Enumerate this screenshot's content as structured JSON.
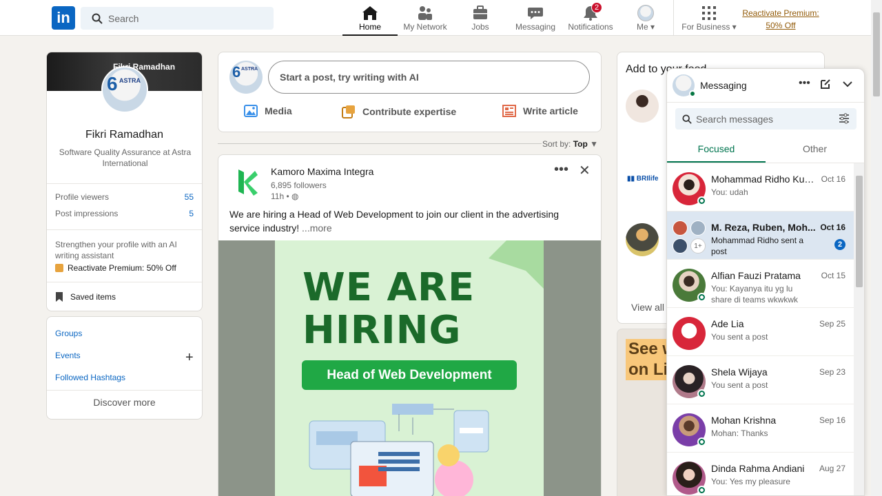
{
  "nav": {
    "logo_text": "in",
    "search_placeholder": "Search",
    "items": [
      {
        "label": "Home",
        "icon": "home-icon",
        "active": true
      },
      {
        "label": "My Network",
        "icon": "network-icon"
      },
      {
        "label": "Jobs",
        "icon": "briefcase-icon"
      },
      {
        "label": "Messaging",
        "icon": "chat-icon"
      },
      {
        "label": "Notifications",
        "icon": "bell-icon",
        "badge": "2"
      },
      {
        "label": "Me",
        "icon": "avatar-icon"
      },
      {
        "label": "For Business",
        "icon": "grid-icon"
      }
    ],
    "premium_line1": "Reactivate Premium:",
    "premium_line2": "50% Off"
  },
  "profile": {
    "cover_text": "Fikri Ramadhan",
    "name": "Fikri Ramadhan",
    "title": "Software Quality Assurance at Astra International",
    "stats": [
      {
        "label": "Profile viewers",
        "value": "55"
      },
      {
        "label": "Post impressions",
        "value": "5"
      }
    ],
    "promo_text": "Strengthen your profile with an AI writing assistant",
    "promo_link": "Reactivate Premium: 50% Off",
    "saved_items": "Saved items"
  },
  "left_links": {
    "groups": "Groups",
    "events": "Events",
    "hashtags": "Followed Hashtags",
    "discover": "Discover more"
  },
  "share": {
    "placeholder": "Start a post, try writing with AI",
    "actions": [
      "Media",
      "Contribute expertise",
      "Write article"
    ]
  },
  "sort": {
    "label": "Sort by:",
    "value": "Top"
  },
  "post": {
    "company": "Kamoro Maxima Integra",
    "followers": "6,895 followers",
    "time": "11h •",
    "text": "We are hiring a Head of Web Development to join our client in the advertising service industry!",
    "more": "...more",
    "image_title": "WE ARE HIRING",
    "image_role": "Head of Web Development"
  },
  "feed": {
    "title": "Add to your feed",
    "company_label": "BRIlife",
    "view_all": "View all",
    "ad_text_1": "See w",
    "ad_text_2": "on Li"
  },
  "messaging": {
    "title": "Messaging",
    "search_placeholder": "Search messages",
    "tabs": [
      "Focused",
      "Other"
    ],
    "conversations": [
      {
        "name": "Mohammad Ridho Kus...",
        "date": "Oct 16",
        "preview": "You: udah",
        "online": true,
        "color": "#d8263a"
      },
      {
        "name": "M. Reza, Ruben, Moh...",
        "date": "Oct 16",
        "preview": "Mohammad Ridho sent a post",
        "badge": "2",
        "group_count": "1+"
      },
      {
        "name": "Alfian Fauzi Pratama",
        "date": "Oct 15",
        "preview": "You: Kayanya itu yg lu share di teams wkwkwk",
        "online": true,
        "color": "#4a7a3a"
      },
      {
        "name": "Ade Lia",
        "date": "Sep 25",
        "preview": "You sent a post",
        "color": "#d8263a"
      },
      {
        "name": "Shela Wijaya",
        "date": "Sep 23",
        "preview": "You sent a post",
        "online": true,
        "color": "#5b4a55"
      },
      {
        "name": "Mohan Krishna",
        "date": "Sep 16",
        "preview": "Mohan: Thanks",
        "online": true,
        "color": "#7a3ea8"
      },
      {
        "name": "Dinda Rahma Andiani",
        "date": "Aug 27",
        "preview": "You: Yes my pleasure",
        "online": true,
        "color": "#b05a8a"
      }
    ]
  }
}
